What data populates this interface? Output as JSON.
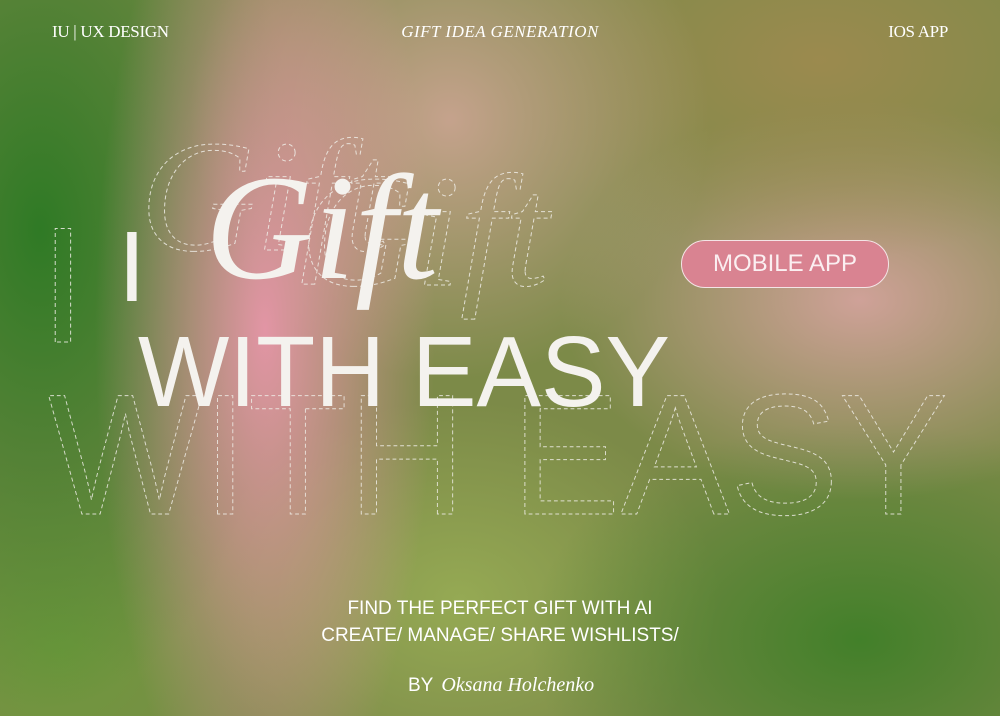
{
  "header": {
    "left": "IU | UX DESIGN",
    "center": "GIFT IDEA GENERATION",
    "right": "IOS APP"
  },
  "hero": {
    "line1_letter": "I",
    "script_word": "Gift",
    "line2": "WITH EASY"
  },
  "badge": {
    "label": "MOBILE APP",
    "color": "#d98391"
  },
  "tagline": {
    "line1": "FIND THE PERFECT GIFT WITH AI",
    "line2": "CREATE/ MANAGE/ SHARE WISHLISTS/"
  },
  "credit": {
    "prefix": "BY",
    "author": "Oksana Holchenko"
  }
}
